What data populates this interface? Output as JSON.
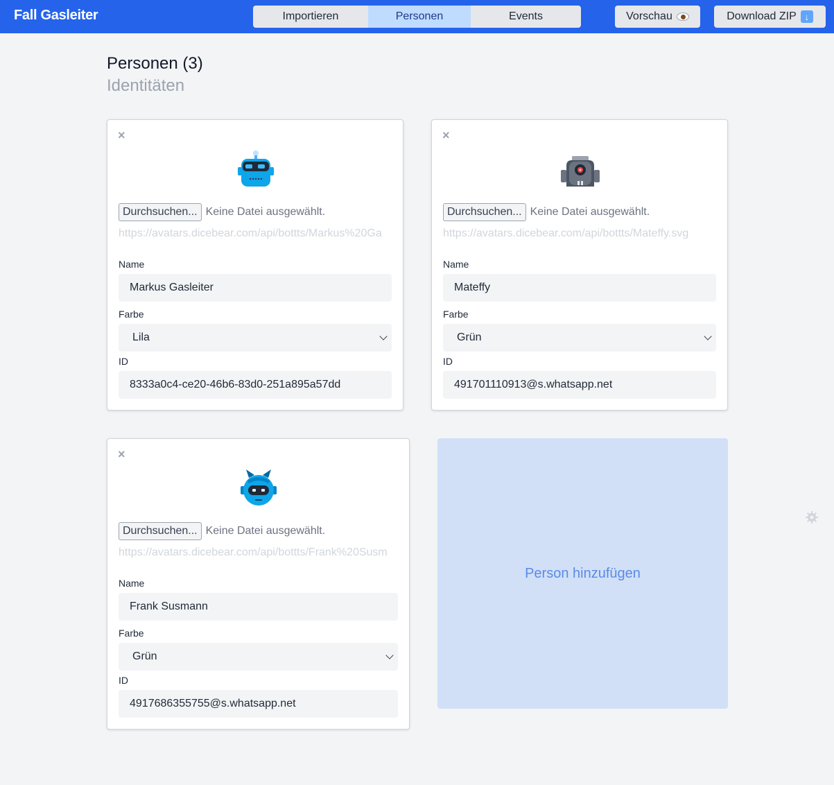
{
  "header": {
    "app_title": "Fall Gasleiter",
    "tabs": [
      {
        "label": "Importieren",
        "active": false
      },
      {
        "label": "Personen",
        "active": true
      },
      {
        "label": "Events",
        "active": false
      }
    ],
    "preview_label": "Vorschau",
    "preview_icon": "eye-icon",
    "download_label": "Download ZIP",
    "download_icon": "down-arrow-icon"
  },
  "page": {
    "title": "Personen (3)",
    "subtitle": "Identitäten"
  },
  "labels": {
    "browse": "Durchsuchen...",
    "no_file": "Keine Datei ausgewählt.",
    "name": "Name",
    "color": "Farbe",
    "id": "ID"
  },
  "persons": [
    {
      "avatar_url": "https://avatars.dicebear.com/api/bottts/Markus%20Gasleiter.svg",
      "avatar_url_visible": "https://avatars.dicebear.com/api/bottts/Markus%20Ga",
      "name": "Markus Gasleiter",
      "color": "Lila",
      "id": "8333a0c4-ce20-46b6-83d0-251a895a57dd"
    },
    {
      "avatar_url": "https://avatars.dicebear.com/api/bottts/Mateffy.svg",
      "avatar_url_visible": "https://avatars.dicebear.com/api/bottts/Mateffy.svg",
      "name": "Mateffy",
      "color": "Grün",
      "id": "491701110913@s.whatsapp.net"
    },
    {
      "avatar_url": "https://avatars.dicebear.com/api/bottts/Frank%20Susmann.svg",
      "avatar_url_visible": "https://avatars.dicebear.com/api/bottts/Frank%20Susm",
      "name": "Frank Susmann",
      "color": "Grün",
      "id": "4917686355755@s.whatsapp.net"
    }
  ],
  "add_person_label": "Person hinzufügen",
  "colors": {
    "topbar": "#2563eb",
    "active_tab": "#bfdbfe",
    "add_card_bg": "#d1e0f7",
    "add_card_text": "#5b8ae6"
  }
}
